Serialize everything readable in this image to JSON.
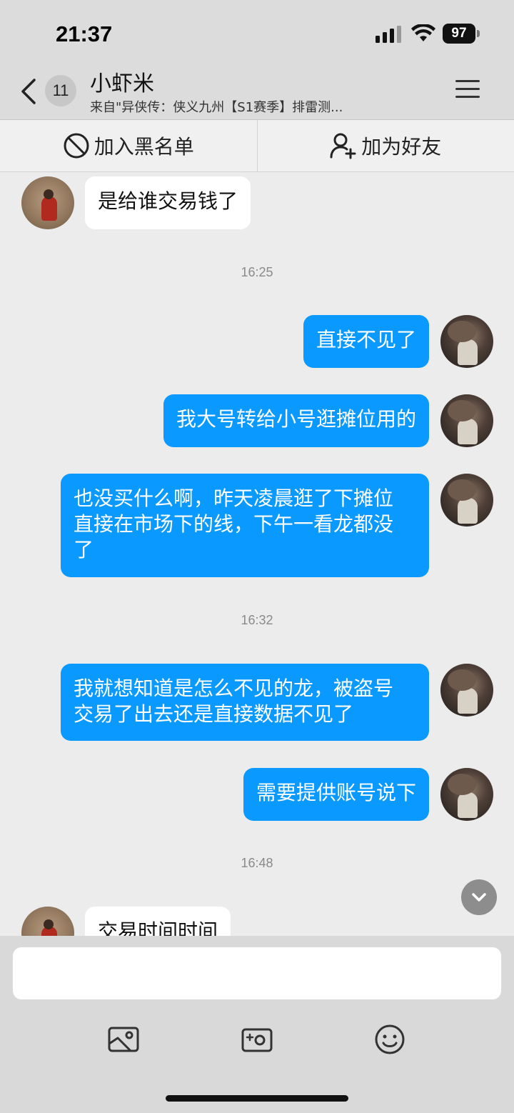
{
  "status_bar": {
    "time": "21:37",
    "battery": "97"
  },
  "header": {
    "unread_count": "11",
    "title": "小虾米",
    "subtitle": "来自\"异侠传：侠义九州【S1赛季】排雷测..."
  },
  "actions": {
    "blacklist_label": "加入黑名单",
    "add_friend_label": "加为好友"
  },
  "messages": [
    {
      "side": "in",
      "text": "是给谁交易钱了"
    },
    {
      "type": "time",
      "text": "16:25"
    },
    {
      "side": "out",
      "text": "直接不见了"
    },
    {
      "side": "out",
      "text": "我大号转给小号逛摊位用的"
    },
    {
      "side": "out",
      "text_lines": [
        "也没买什么啊，昨天凌晨逛了下摊位",
        "直接在市场下的线，下午一看龙都没",
        "了"
      ]
    },
    {
      "type": "time",
      "text": "16:32"
    },
    {
      "side": "out",
      "text_lines": [
        "我就想知道是怎么不见的龙，被盗号",
        "交易了出去还是直接数据不见了"
      ]
    },
    {
      "side": "out",
      "text": "需要提供账号说下"
    },
    {
      "type": "time",
      "text": "16:48"
    },
    {
      "side": "in",
      "text": "交易时间时间"
    }
  ],
  "input": {
    "value": "",
    "placeholder": ""
  },
  "icons": {
    "back": "chevron-left-icon",
    "menu": "hamburger-menu-icon",
    "blacklist": "block-icon",
    "add_friend": "add-user-icon",
    "scroll_down": "chevron-down-icon",
    "image": "image-icon",
    "camera": "camera-icon",
    "emoji": "emoji-icon"
  },
  "colors": {
    "outgoing_bubble": "#0a99ff",
    "incoming_bubble": "#ffffff",
    "background": "#ececec"
  }
}
